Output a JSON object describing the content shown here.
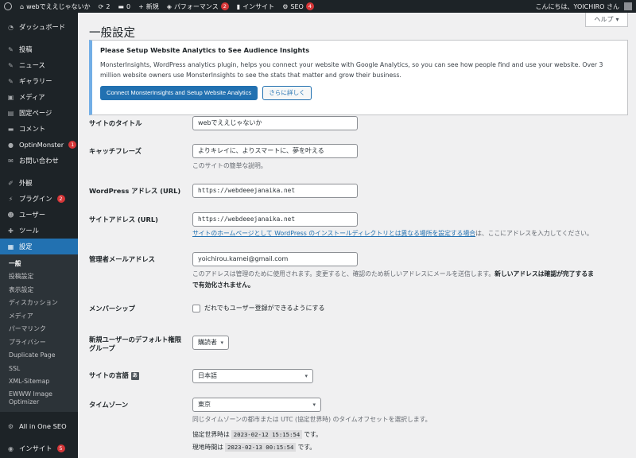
{
  "topbar": {
    "site_name": "webでええじゃないか",
    "updates_count": "2",
    "comments_count": "0",
    "new_label": "新規",
    "performance_label": "パフォーマンス",
    "performance_badge": "2",
    "insights_label": "インサイト",
    "seo_label": "SEO",
    "seo_badge": "4",
    "greeting": "こんにちは、YOICHIRO さん"
  },
  "sidebar": {
    "dashboard": "ダッシュボード",
    "posts": "投稿",
    "news": "ニュース",
    "gallery": "ギャラリー",
    "media": "メディア",
    "pages": "固定ページ",
    "comments": "コメント",
    "optinmonster": "OptinMonster",
    "optinmonster_badge": "1",
    "contact": "お問い合わせ",
    "appearance": "外観",
    "plugins": "プラグイン",
    "plugins_badge": "2",
    "users": "ユーザー",
    "tools": "ツール",
    "settings": "設定",
    "submenu": [
      "一般",
      "投稿設定",
      "表示設定",
      "ディスカッション",
      "メディア",
      "パーマリンク",
      "プライバシー",
      "Duplicate Page",
      "SSL",
      "XML-Sitemap",
      "EWWW Image Optimizer"
    ],
    "aioseo": "All in One SEO",
    "insights": "インサイト",
    "insights_badge": "5"
  },
  "help_tab": {
    "label": "ヘルプ"
  },
  "page_title": "一般設定",
  "notice": {
    "title": "Please Setup Website Analytics to See Audience Insights",
    "text": "MonsterInsights, WordPress analytics plugin, helps you connect your website with Google Analytics, so you can see how people find and use your website. Over 3 million website owners use MonsterInsights to see the stats that matter and grow their business.",
    "primary_button": "Connect MonsterInsights and Setup Website Analytics",
    "secondary_button": "さらに詳しく"
  },
  "form": {
    "site_title_label": "サイトのタイトル",
    "site_title_value": "webでええじゃないか",
    "tagline_label": "キャッチフレーズ",
    "tagline_value": "よりキレイに、よりスマートに、夢を叶える",
    "tagline_desc": "このサイトの簡単な説明。",
    "wp_address_label": "WordPress アドレス (URL)",
    "wp_address_value": "https://webdeeejanaika.net",
    "site_address_label": "サイトアドレス (URL)",
    "site_address_value": "https://webdeeejanaika.net",
    "site_address_link": "サイトのホームページとして WordPress のインストールディレクトリとは異なる場所を設定する場合",
    "site_address_desc_tail": "は、ここにアドレスを入力してください。",
    "admin_email_label": "管理者メールアドレス",
    "admin_email_value": "yoichirou.kamei@gmail.com",
    "admin_email_desc_1": "このアドレスは管理のために使用されます。変更すると、確認のため新しいアドレスにメールを送信します。",
    "admin_email_desc_bold_1": "新しいアドレスは確認が完了するま",
    "admin_email_desc_bold_2": "で有効化されません。",
    "membership_label": "メンバーシップ",
    "membership_checkbox": "だれでもユーザー登録ができるようにする",
    "default_role_label": "新規ユーザーのデフォルト権限グループ",
    "default_role_value": "購読者",
    "site_language_label": "サイトの言語",
    "site_language_value": "日本語",
    "timezone_label": "タイムゾーン",
    "timezone_value": "東京",
    "timezone_desc": "同じタイムゾーンの都市または UTC (協定世界時) のタイムオフセットを選択します。",
    "utc_prefix": "協定世界時は",
    "utc_time": "2023-02-12 15:15:54",
    "utc_suffix": "です。",
    "local_prefix": "現地時間は",
    "local_time": "2023-02-13 00:15:54",
    "local_suffix": "です。"
  }
}
